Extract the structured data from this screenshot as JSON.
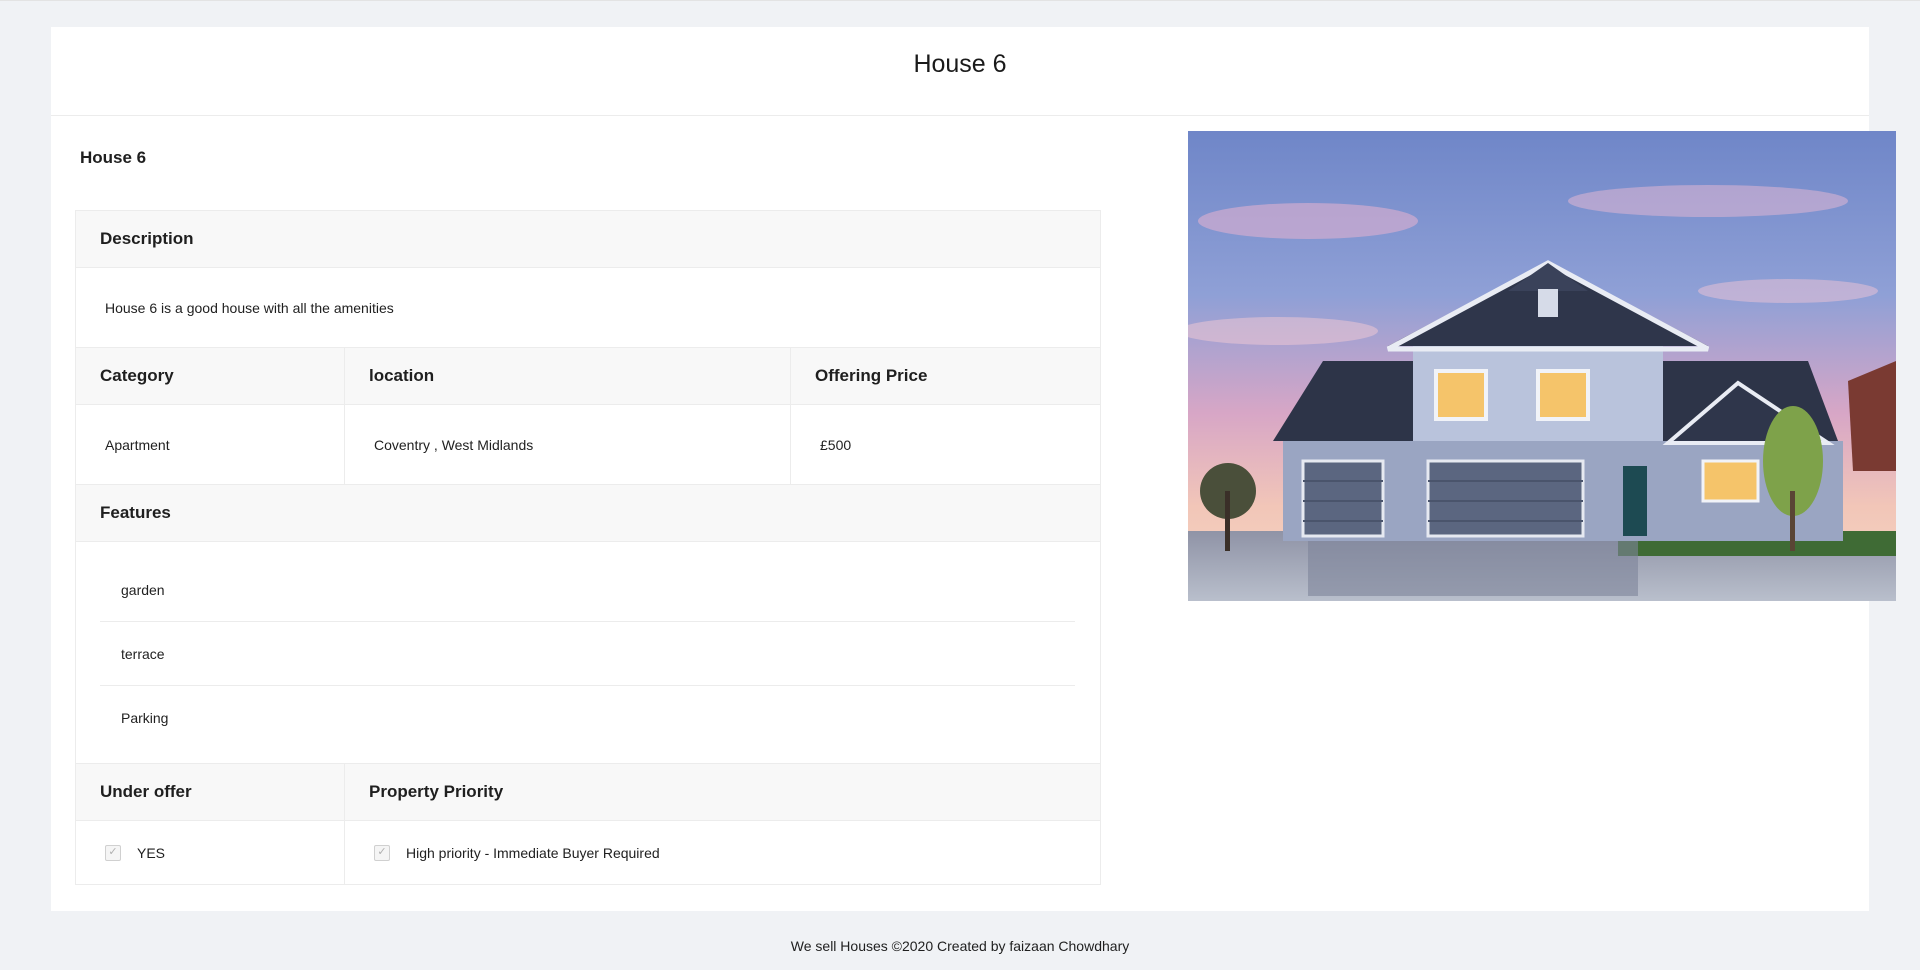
{
  "page": {
    "title": "House 6",
    "subtitle": "House 6"
  },
  "description": {
    "header": "Description",
    "text": "House 6 is a good house with all the amenities"
  },
  "details": {
    "headers": [
      "Category",
      "location",
      "Offering Price"
    ],
    "values": [
      "Apartment",
      "Coventry , West Midlands",
      "£500"
    ]
  },
  "features": {
    "header": "Features",
    "items": [
      "garden",
      "terrace",
      "Parking"
    ]
  },
  "status": {
    "under_offer_header": "Under offer",
    "priority_header": "Property Priority",
    "under_offer_value": "YES",
    "priority_value": "High priority - Immediate Buyer Required",
    "checkmark": "✓"
  },
  "image": {
    "subject": "house-photo"
  },
  "footer": {
    "text": "We sell Houses ©2020 Created by faizaan Chowdhary"
  },
  "colors": {
    "background": "#f0f2f5",
    "card": "#ffffff",
    "header_bg": "#f8f8f8",
    "border": "#ececec"
  }
}
